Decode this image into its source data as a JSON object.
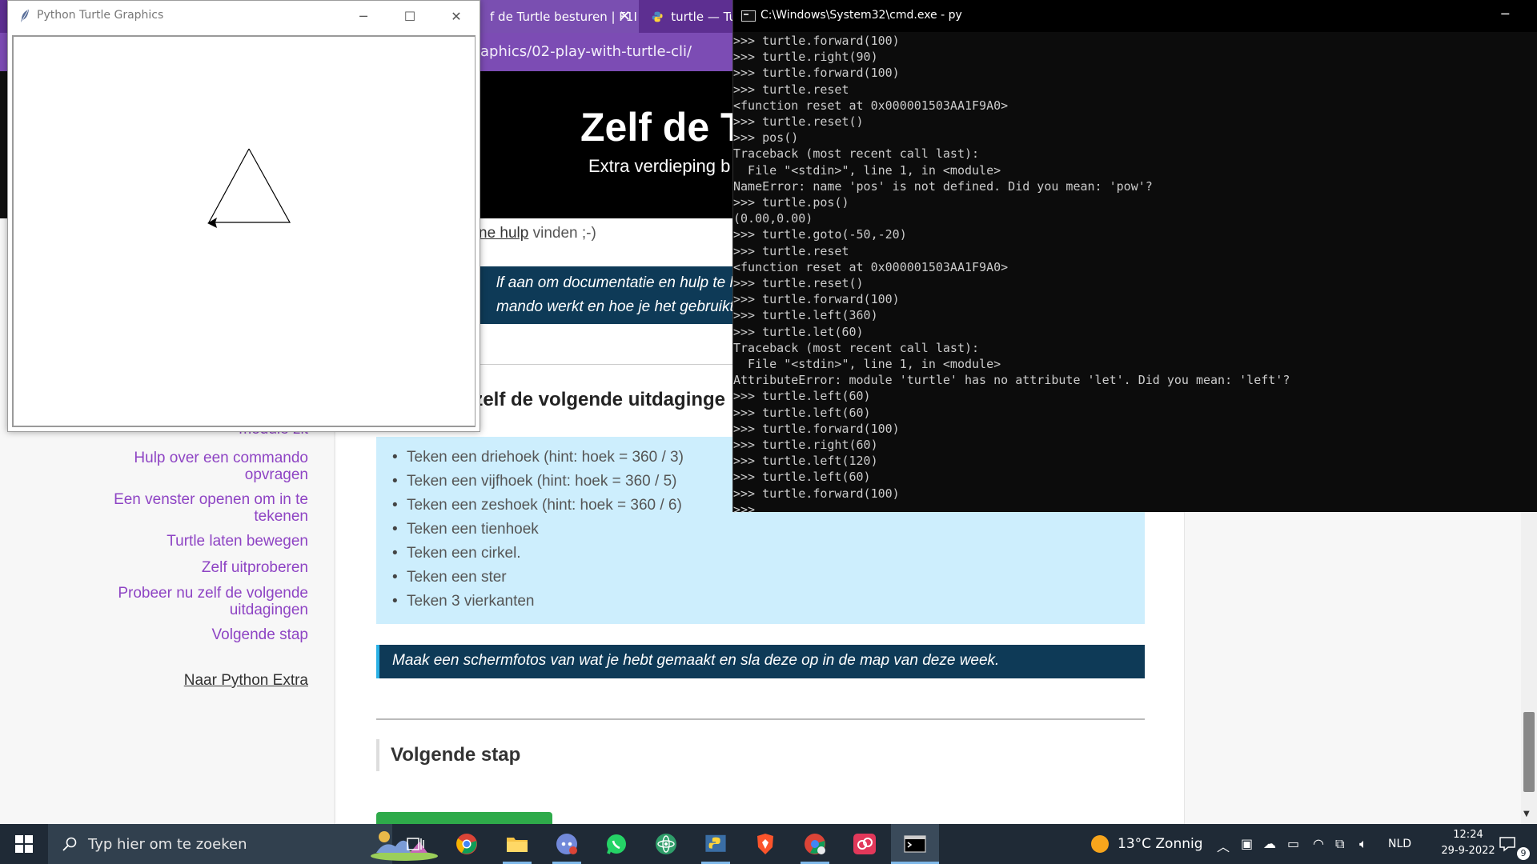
{
  "browser": {
    "tabs": [
      {
        "label": "f de Turtle besturen | F1I"
      },
      {
        "label": "turtle — Tu"
      }
    ],
    "url": "aphics/02-play-with-turtle-cli/",
    "header": {
      "title": "Zelf de T",
      "subtitle": "Extra verdieping b"
    }
  },
  "sidebar": {
    "items": [
      {
        "label": "module zit"
      },
      {
        "label": "Hulp over een commando opvragen"
      },
      {
        "label": "Een venster openen om in te tekenen"
      },
      {
        "label": "Turtle laten bewegen"
      },
      {
        "label": "Zelf uitproberen"
      },
      {
        "label": "Probeer nu zelf de volgende uitdagingen"
      },
      {
        "label": "Volgende stap"
      }
    ],
    "extra_link": "Naar Python Extra"
  },
  "content": {
    "help_line_link": "ne hulp",
    "help_line_rest": " vinden ;-)",
    "info_lines": [
      "lf aan om documentatie en hulp te lez",
      "mando werkt en hoe je het gebruikt."
    ],
    "challenge_heading": "u zelf de volgende uitdaginge",
    "challenges": [
      "Teken een driehoek (hint: hoek = 360 / 3)",
      "Teken een vijfhoek (hint: hoek = 360 / 5)",
      "Teken een zeshoek (hint: hoek = 360 / 6)",
      "Teken een tienhoek",
      "Teken een cirkel.",
      "Teken een ster",
      "Teken 3 vierkanten"
    ],
    "note": "Maak een schermfotos van wat je hebt gemaakt en sla deze op in de map van deze week.",
    "next_heading": "Volgende stap"
  },
  "turtle_window": {
    "title": "Python Turtle Graphics",
    "controls": {
      "minimize": "─",
      "maximize": "☐",
      "close": "✕"
    }
  },
  "cmd_window": {
    "title": "C:\\Windows\\System32\\cmd.exe - py",
    "minimize": "─",
    "lines": [
      ">>> turtle.forward(100)",
      ">>> turtle.right(90)",
      ">>> turtle.forward(100)",
      ">>> turtle.reset",
      "<function reset at 0x000001503AA1F9A0>",
      ">>> turtle.reset()",
      ">>> pos()",
      "Traceback (most recent call last):",
      "  File \"<stdin>\", line 1, in <module>",
      "NameError: name 'pos' is not defined. Did you mean: 'pow'?",
      ">>> turtle.pos()",
      "(0.00,0.00)",
      ">>> turtle.goto(-50,-20)",
      ">>> turtle.reset",
      "<function reset at 0x000001503AA1F9A0>",
      ">>> turtle.reset()",
      ">>> turtle.forward(100)",
      ">>> turtle.left(360)",
      ">>> turtle.let(60)",
      "Traceback (most recent call last):",
      "  File \"<stdin>\", line 1, in <module>",
      "AttributeError: module 'turtle' has no attribute 'let'. Did you mean: 'left'?",
      ">>> turtle.left(60)",
      ">>> turtle.left(60)",
      ">>> turtle.forward(100)",
      ">>> turtle.right(60)",
      ">>> turtle.left(120)",
      ">>> turtle.left(60)",
      ">>> turtle.forward(100)",
      ">>> "
    ]
  },
  "taskbar": {
    "search_placeholder": "Typ hier om te zoeken",
    "weather": "13°C  Zonnig",
    "language": "NLD",
    "time": "12:24",
    "date": "29-9-2022",
    "notification_count": "9"
  },
  "colors": {
    "browser_accent": "#5d2f91",
    "link": "#8e44c4",
    "info_box": "#0e3a57",
    "challenge_bg": "#cdeefd",
    "terminal_bg": "#0c0c0c",
    "taskbar_bg": "#1f2a36"
  }
}
